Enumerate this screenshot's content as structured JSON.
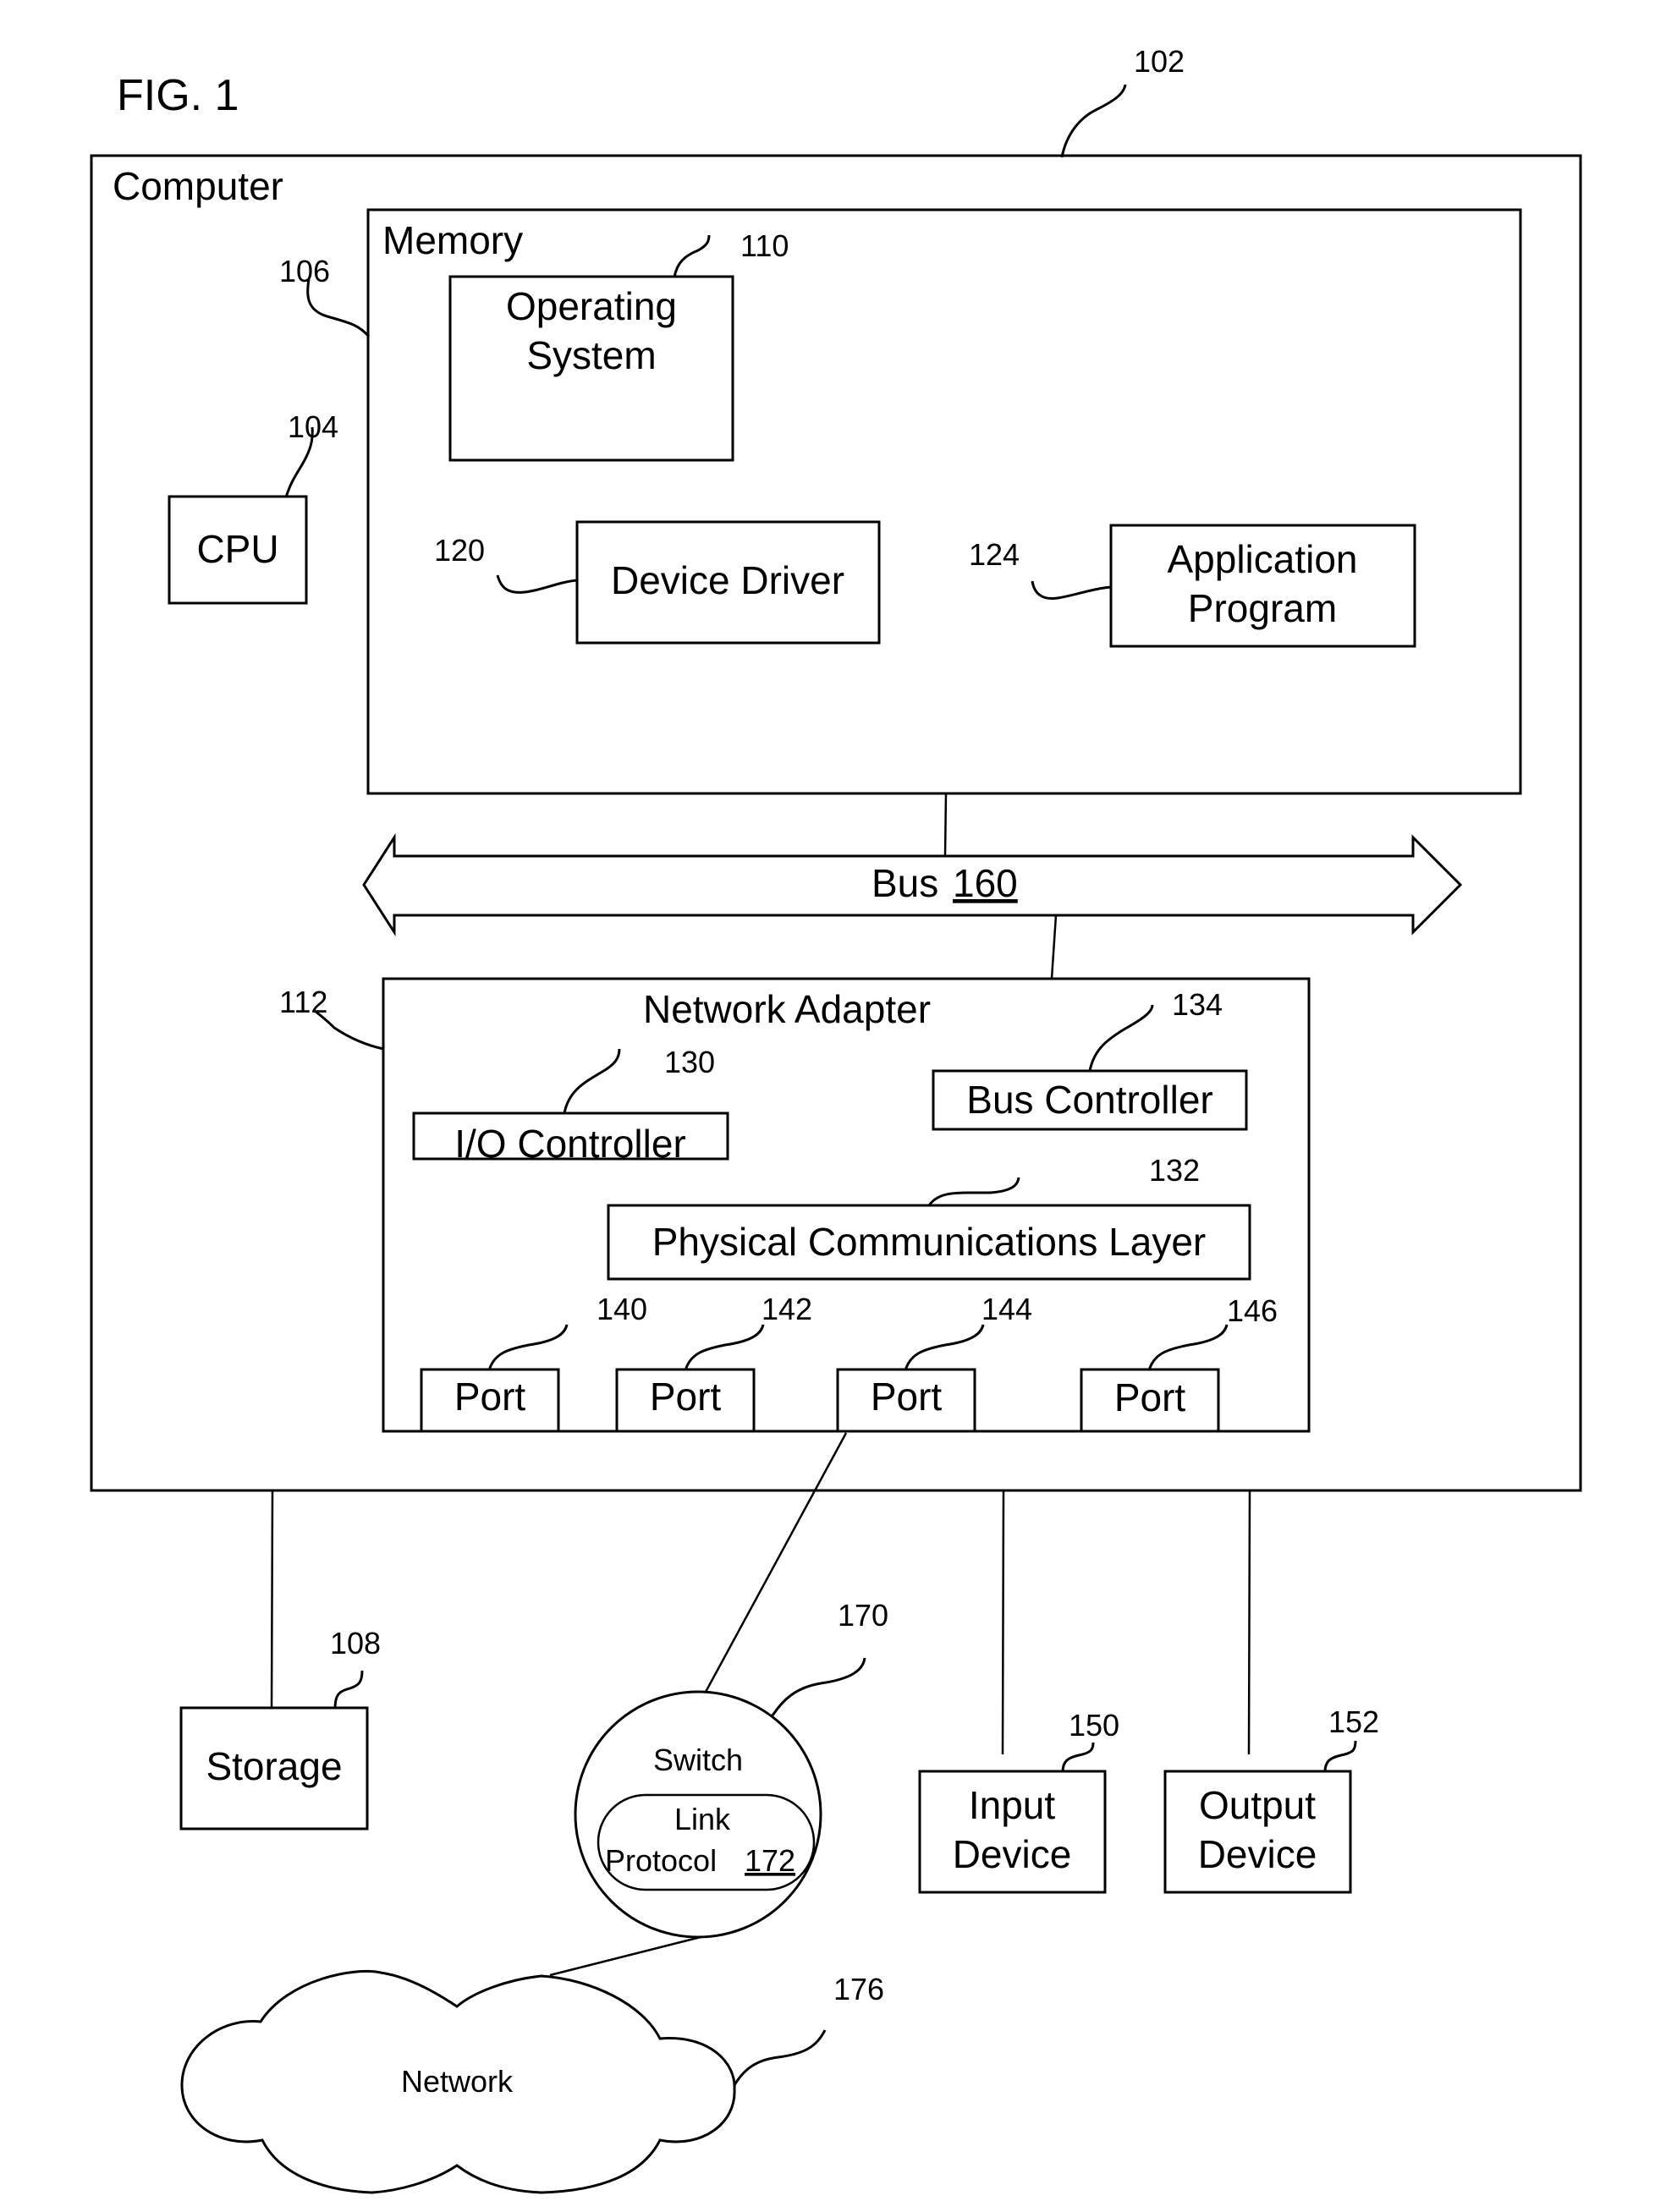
{
  "figure": {
    "title": "FIG. 1",
    "components": {
      "computer": {
        "label": "Computer",
        "ref": "102"
      },
      "memory": {
        "label": "Memory",
        "ref": "106"
      },
      "cpu": {
        "label": "CPU",
        "ref": "104"
      },
      "operating_system": {
        "line1": "Operating",
        "line2": "System",
        "ref": "110"
      },
      "device_driver": {
        "label": "Device Driver",
        "ref": "120"
      },
      "application_program": {
        "line1": "Application",
        "line2": "Program",
        "ref": "124"
      },
      "bus": {
        "label": "Bus",
        "ref": "160"
      },
      "network_adapter": {
        "label": "Network Adapter",
        "ref": "112"
      },
      "io_controller": {
        "label": "I/O Controller",
        "ref": "130"
      },
      "bus_controller": {
        "label": "Bus Controller",
        "ref": "134"
      },
      "physical_layer": {
        "label": "Physical Communications Layer",
        "ref": "132"
      },
      "ports": [
        {
          "label": "Port",
          "ref": "140"
        },
        {
          "label": "Port",
          "ref": "142"
        },
        {
          "label": "Port",
          "ref": "144"
        },
        {
          "label": "Port",
          "ref": "146"
        }
      ],
      "storage": {
        "label": "Storage",
        "ref": "108"
      },
      "switch": {
        "label": "Switch",
        "ref": "170"
      },
      "link_protocol": {
        "line1": "Link",
        "line2": "Protocol",
        "ref": "172"
      },
      "input_device": {
        "line1": "Input",
        "line2": "Device",
        "ref": "150"
      },
      "output_device": {
        "line1": "Output",
        "line2": "Device",
        "ref": "152"
      },
      "network": {
        "label": "Network",
        "ref": "176"
      }
    }
  }
}
